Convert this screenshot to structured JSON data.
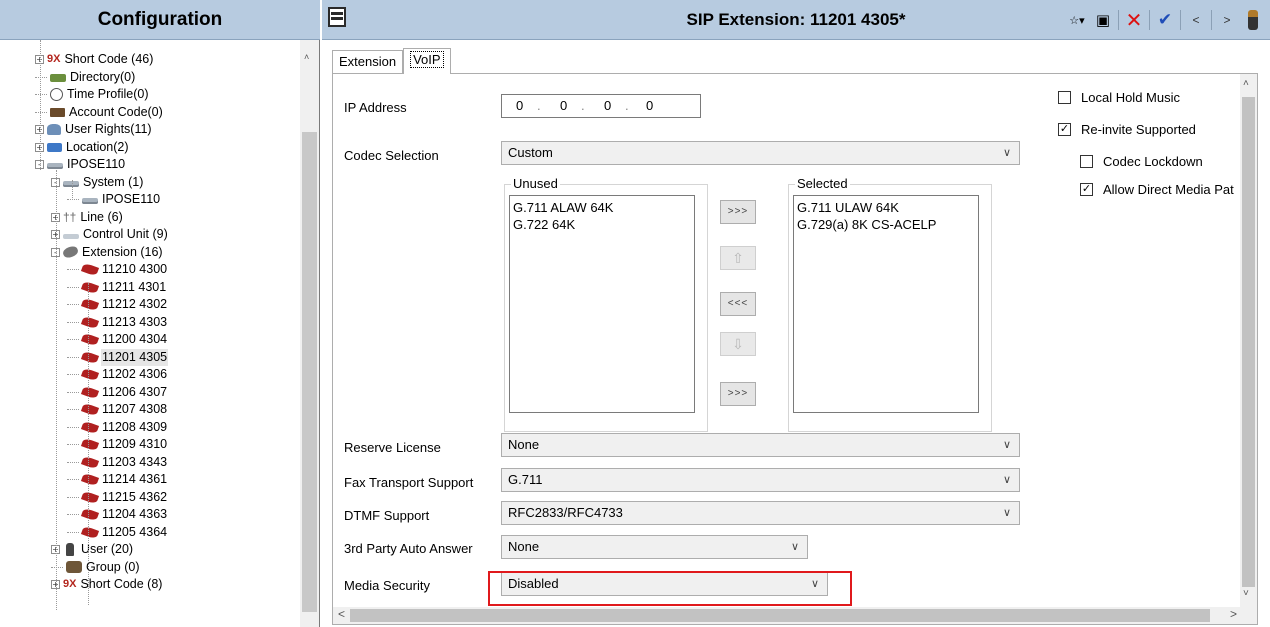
{
  "left_panel": {
    "title": "Configuration",
    "tree": [
      {
        "label": "Short Code (46)",
        "icon": "short-code-icon",
        "expander": "+"
      },
      {
        "label": "Directory(0)",
        "icon": "directory-icon",
        "expander": ""
      },
      {
        "label": "Time Profile(0)",
        "icon": "clock-icon",
        "expander": ""
      },
      {
        "label": "Account Code(0)",
        "icon": "account-code-icon",
        "expander": ""
      },
      {
        "label": "User Rights(11)",
        "icon": "user-rights-icon",
        "expander": "+"
      },
      {
        "label": "Location(2)",
        "icon": "location-icon",
        "expander": "+"
      },
      {
        "label": "IPOSE110",
        "icon": "system-icon",
        "expander": "-"
      },
      {
        "label": "System (1)",
        "icon": "system-icon",
        "expander": "-"
      },
      {
        "label": "IPOSE110",
        "icon": "system-icon",
        "expander": ""
      },
      {
        "label": "Line (6)",
        "icon": "line-icon",
        "expander": "+"
      },
      {
        "label": "Control Unit (9)",
        "icon": "control-unit-icon",
        "expander": "+"
      },
      {
        "label": "Extension (16)",
        "icon": "extension-folder-icon",
        "expander": "-"
      },
      {
        "label": "11210 4300",
        "icon": "extension-icon",
        "expander": ""
      },
      {
        "label": "11211 4301",
        "icon": "extension-icon",
        "expander": ""
      },
      {
        "label": "11212 4302",
        "icon": "extension-icon",
        "expander": ""
      },
      {
        "label": "11213 4303",
        "icon": "extension-icon",
        "expander": ""
      },
      {
        "label": "11200 4304",
        "icon": "extension-icon",
        "expander": ""
      },
      {
        "label": "11201 4305",
        "icon": "extension-icon",
        "expander": "",
        "selected": true
      },
      {
        "label": "11202 4306",
        "icon": "extension-icon",
        "expander": ""
      },
      {
        "label": "11206 4307",
        "icon": "extension-icon",
        "expander": ""
      },
      {
        "label": "11207 4308",
        "icon": "extension-icon",
        "expander": ""
      },
      {
        "label": "11208 4309",
        "icon": "extension-icon",
        "expander": ""
      },
      {
        "label": "11209 4310",
        "icon": "extension-icon",
        "expander": ""
      },
      {
        "label": "11203 4343",
        "icon": "extension-icon",
        "expander": ""
      },
      {
        "label": "11214 4361",
        "icon": "extension-icon",
        "expander": ""
      },
      {
        "label": "11215 4362",
        "icon": "extension-icon",
        "expander": ""
      },
      {
        "label": "11204 4363",
        "icon": "extension-icon",
        "expander": ""
      },
      {
        "label": "11205 4364",
        "icon": "extension-icon",
        "expander": ""
      },
      {
        "label": "User (20)",
        "icon": "user-icon",
        "expander": "+"
      },
      {
        "label": "Group (0)",
        "icon": "group-icon",
        "expander": ""
      },
      {
        "label": "Short Code (8)",
        "icon": "short-code-icon",
        "expander": "+"
      }
    ],
    "short_code_glyph": "9X",
    "line_glyph": "††"
  },
  "header": {
    "title": "SIP Extension: 11201 4305*"
  },
  "toolbar": {
    "new_icon": "new-icon",
    "new_glyph": "☆▾",
    "save_icon": "save-icon",
    "save_glyph": "▣",
    "delete_glyph": "✕",
    "ok_glyph": "✔",
    "prev_glyph": "<",
    "next_glyph": ">"
  },
  "tabs": [
    {
      "label": "Extension"
    },
    {
      "label": "VoIP"
    }
  ],
  "voip": {
    "ip_address": {
      "label": "IP Address",
      "octets": [
        "0",
        "0",
        "0",
        "0"
      ]
    },
    "codec_selection": {
      "label": "Codec Selection",
      "value": "Custom"
    },
    "unused": {
      "title": "Unused",
      "items": [
        "G.711 ALAW 64K",
        "G.722 64K"
      ]
    },
    "selected": {
      "title": "Selected",
      "items": [
        "G.711 ULAW 64K",
        "G.729(a) 8K CS-ACELP"
      ]
    },
    "move_buttons": [
      ">>>",
      "⇧",
      "<<<",
      "⇩",
      ">>>"
    ],
    "reserve_license": {
      "label": "Reserve License",
      "value": "None"
    },
    "fax_transport": {
      "label": "Fax Transport Support",
      "value": "G.711"
    },
    "dtmf": {
      "label": "DTMF Support",
      "value": "RFC2833/RFC4733"
    },
    "auto_answer": {
      "label": "3rd Party Auto Answer",
      "value": "None"
    },
    "media_security": {
      "label": "Media Security",
      "value": "Disabled"
    },
    "checkboxes": [
      {
        "label": "Local Hold Music",
        "checked": false
      },
      {
        "label": "Re-invite Supported",
        "checked": true
      },
      {
        "label": "Codec Lockdown",
        "checked": false
      },
      {
        "label": "Allow Direct Media Pat",
        "checked": true
      }
    ],
    "dropdown_chevron": "∨",
    "check_glyph": "✓"
  },
  "scroll": {
    "up": "˄",
    "down": "˅",
    "left": "<",
    "right": ">"
  },
  "colors": {
    "header_bg": "#b7cbe0",
    "highlight": "#e0191c",
    "extension_icon": "#b02020"
  }
}
